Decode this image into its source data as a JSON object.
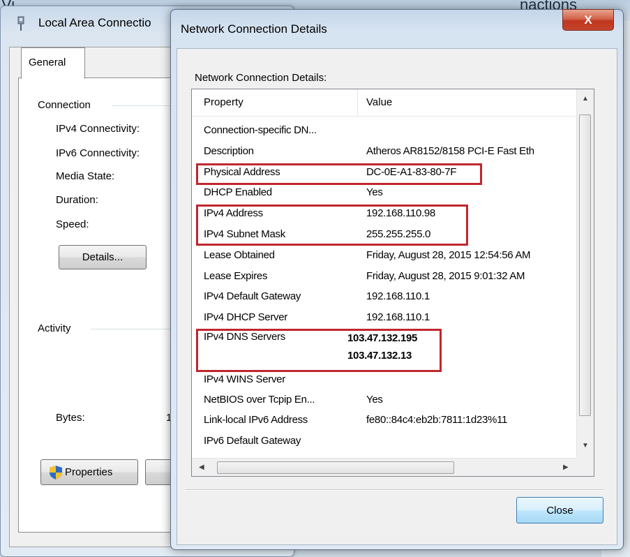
{
  "background": {
    "title_fragment_left": "Vi",
    "title_fragment_right": "nactions"
  },
  "lac_window": {
    "title": "Local Area Connectio",
    "tab_general": "General",
    "connection_group": "Connection",
    "fields": [
      "IPv4 Connectivity:",
      "IPv6 Connectivity:",
      "Media State:",
      "Duration:",
      "Speed:"
    ],
    "details_button": "Details...",
    "activity_group": "Activity",
    "bytes_label": "Bytes:",
    "bytes_value_fragment": "1",
    "properties_button": "Properties"
  },
  "dialog": {
    "title": "Network Connection Details",
    "section_label": "Network Connection Details:",
    "columns": {
      "property": "Property",
      "value": "Value"
    },
    "rows": [
      {
        "property": "Connection-specific DN...",
        "value": ""
      },
      {
        "property": "Description",
        "value": "Atheros AR8152/8158 PCI-E Fast Eth"
      },
      {
        "property": "Physical Address",
        "value": "DC-0E-A1-83-80-7F"
      },
      {
        "property": "DHCP Enabled",
        "value": "Yes"
      },
      {
        "property": "IPv4 Address",
        "value": "192.168.110.98"
      },
      {
        "property": "IPv4 Subnet Mask",
        "value": "255.255.255.0"
      },
      {
        "property": "Lease Obtained",
        "value": "Friday, August 28, 2015 12:54:56 AM"
      },
      {
        "property": "Lease Expires",
        "value": "Friday, August 28, 2015 9:01:32 AM"
      },
      {
        "property": "IPv4 Default Gateway",
        "value": "192.168.110.1"
      },
      {
        "property": "IPv4 DHCP Server",
        "value": "192.168.110.1"
      },
      {
        "property": "IPv4 DNS Servers",
        "value": "103.47.132.195"
      },
      {
        "property": "",
        "value": "103.47.132.13"
      },
      {
        "property": "IPv4 WINS Server",
        "value": ""
      },
      {
        "property": "NetBIOS over Tcpip En...",
        "value": "Yes"
      },
      {
        "property": "Link-local IPv6 Address",
        "value": "fe80::84c4:eb2b:7811:1d23%11"
      },
      {
        "property": "IPv6 Default Gateway",
        "value": ""
      }
    ],
    "close_button": "Close",
    "close_x": "X"
  },
  "colors": {
    "highlight_red": "#c0272d",
    "title_close": "#c7402a"
  },
  "icons": [
    "network-adapter-icon",
    "shield-icon",
    "scroll-up-icon",
    "scroll-down-icon",
    "scroll-left-icon",
    "scroll-right-icon"
  ]
}
